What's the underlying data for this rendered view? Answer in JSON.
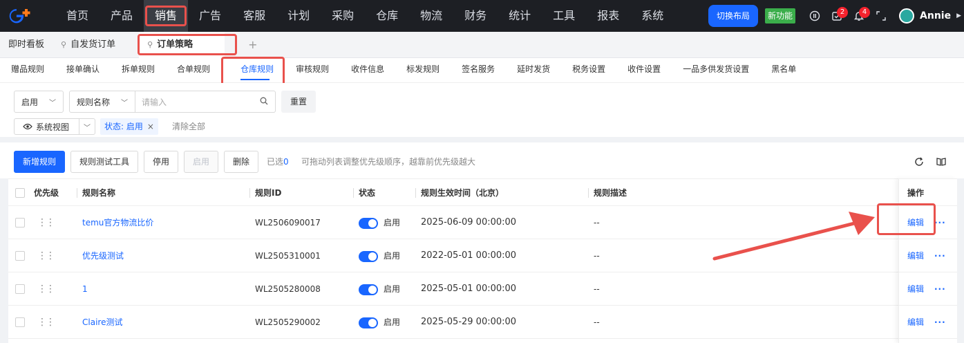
{
  "nav": {
    "items": [
      "首页",
      "产品",
      "销售",
      "广告",
      "客服",
      "计划",
      "采购",
      "仓库",
      "物流",
      "财务",
      "统计",
      "工具",
      "报表",
      "系统"
    ],
    "active_index": 2,
    "switch_layout": "切换布局",
    "new_feature": "新功能",
    "task_badge": "2",
    "notify_badge": "4",
    "user_name": "Annie"
  },
  "page_tabs": {
    "dashboard": "即时看板",
    "self_ship_orders": "自发货订单",
    "order_strategy": "订单策略",
    "add": "+"
  },
  "sub_tabs": [
    "赠品规则",
    "接单确认",
    "拆单规则",
    "合单规则",
    "仓库规则",
    "审核规则",
    "收件信息",
    "标发规则",
    "签名服务",
    "延时发货",
    "税务设置",
    "收件设置",
    "一品多供发货设置",
    "黑名单"
  ],
  "sub_tab_active": 4,
  "filters": {
    "status_value": "启用",
    "field_value": "规则名称",
    "search_placeholder": "请输入",
    "reset": "重置",
    "view_label": "系统视图",
    "chip_text": "状态: 启用",
    "chip_close": "×",
    "clear_all": "清除全部"
  },
  "toolbar": {
    "add_rule": "新增规则",
    "test_tool": "规则测试工具",
    "disable": "停用",
    "enable": "启用",
    "delete": "删除",
    "selected_label": "已选",
    "selected_count": "0",
    "hint": "可拖动列表调整优先级顺序，越靠前优先级越大"
  },
  "table": {
    "headers": {
      "priority": "优先级",
      "name": "规则名称",
      "id": "规则ID",
      "status": "状态",
      "effective_time": "规则生效时间（北京）",
      "desc": "规则描述",
      "ops": "操作"
    },
    "rows": [
      {
        "name": "temu官方物流比价",
        "id": "WL2506090017",
        "status": "启用",
        "time": "2025-06-09 00:00:00",
        "desc": "--",
        "edit": "编辑",
        "more": "···"
      },
      {
        "name": "优先级测试",
        "id": "WL2505310001",
        "status": "启用",
        "time": "2022-05-01 00:00:00",
        "desc": "--",
        "edit": "编辑",
        "more": "···"
      },
      {
        "name": "1",
        "id": "WL2505280008",
        "status": "启用",
        "time": "2025-05-01 00:00:00",
        "desc": "--",
        "edit": "编辑",
        "more": "···"
      },
      {
        "name": "Claire测试",
        "id": "WL2505290002",
        "status": "启用",
        "time": "2025-05-29 00:00:00",
        "desc": "--",
        "edit": "编辑",
        "more": "···"
      }
    ]
  },
  "colors": {
    "primary": "#1966ff",
    "annotation": "#e9514c",
    "topbar": "#1d1f24"
  }
}
